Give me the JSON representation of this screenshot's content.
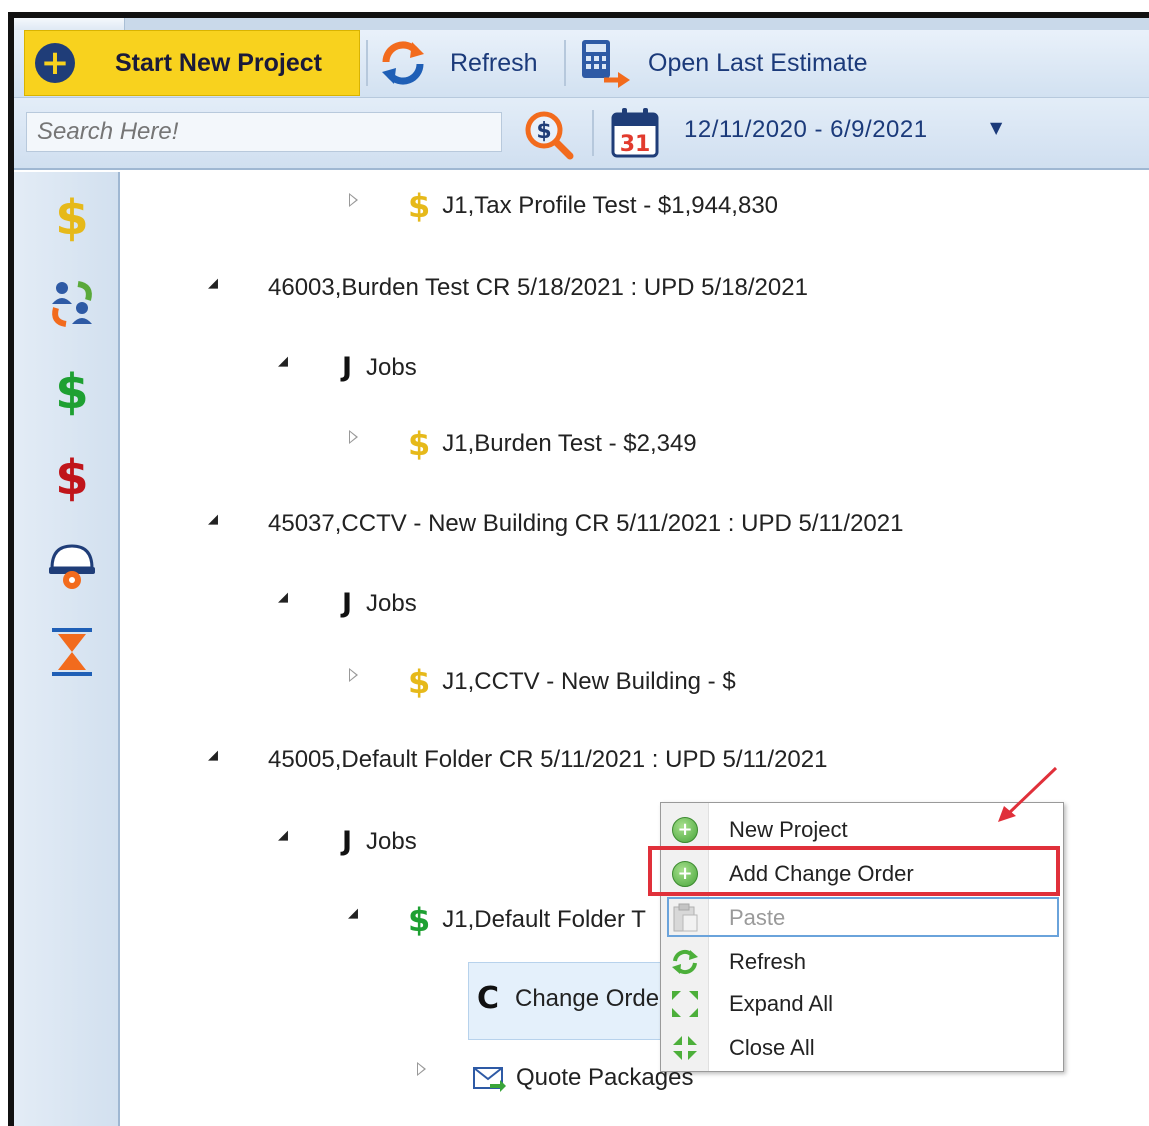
{
  "toolbar": {
    "start_label": "Start New Project",
    "refresh_label": "Refresh",
    "estimate_label": "Open Last Estimate"
  },
  "search": {
    "placeholder": "Search Here!",
    "calendar_day": "31",
    "date_range": "12/11/2020 - 6/9/2021"
  },
  "sidebar": {
    "icons": [
      "gold-dollar-icon",
      "users-exchange-icon",
      "green-dollar-icon",
      "red-dollar-icon",
      "hardhat-gear-icon",
      "hourglass-icon"
    ]
  },
  "tree": {
    "tax_profile": "J1,Tax Profile Test - $1,944,830",
    "project1": "46003,Burden Test CR 5/18/2021 : UPD 5/18/2021",
    "jobs1": "Jobs",
    "job1": "J1,Burden Test - $2,349",
    "project2": "45037,CCTV - New Building CR 5/11/2021 : UPD 5/11/2021",
    "jobs2": "Jobs",
    "job2": "J1,CCTV - New Building - $",
    "project3": "45005,Default Folder CR 5/11/2021 : UPD 5/11/2021",
    "jobs3": "Jobs",
    "job3": "J1,Default Folder T",
    "change_orders": "Change Orde",
    "quote_packages": "Quote Packages"
  },
  "context_menu": {
    "items": [
      "New Project",
      "Add Change Order",
      "Paste",
      "Refresh",
      "Expand All",
      "Close All"
    ]
  },
  "colors": {
    "accent_yellow": "#f8d21e",
    "nav_blue": "#1b3a7a",
    "highlight_red": "#e0303a",
    "dollar_gold": "#e6b91a",
    "dollar_green": "#1ea032",
    "dollar_red": "#c0151b"
  }
}
